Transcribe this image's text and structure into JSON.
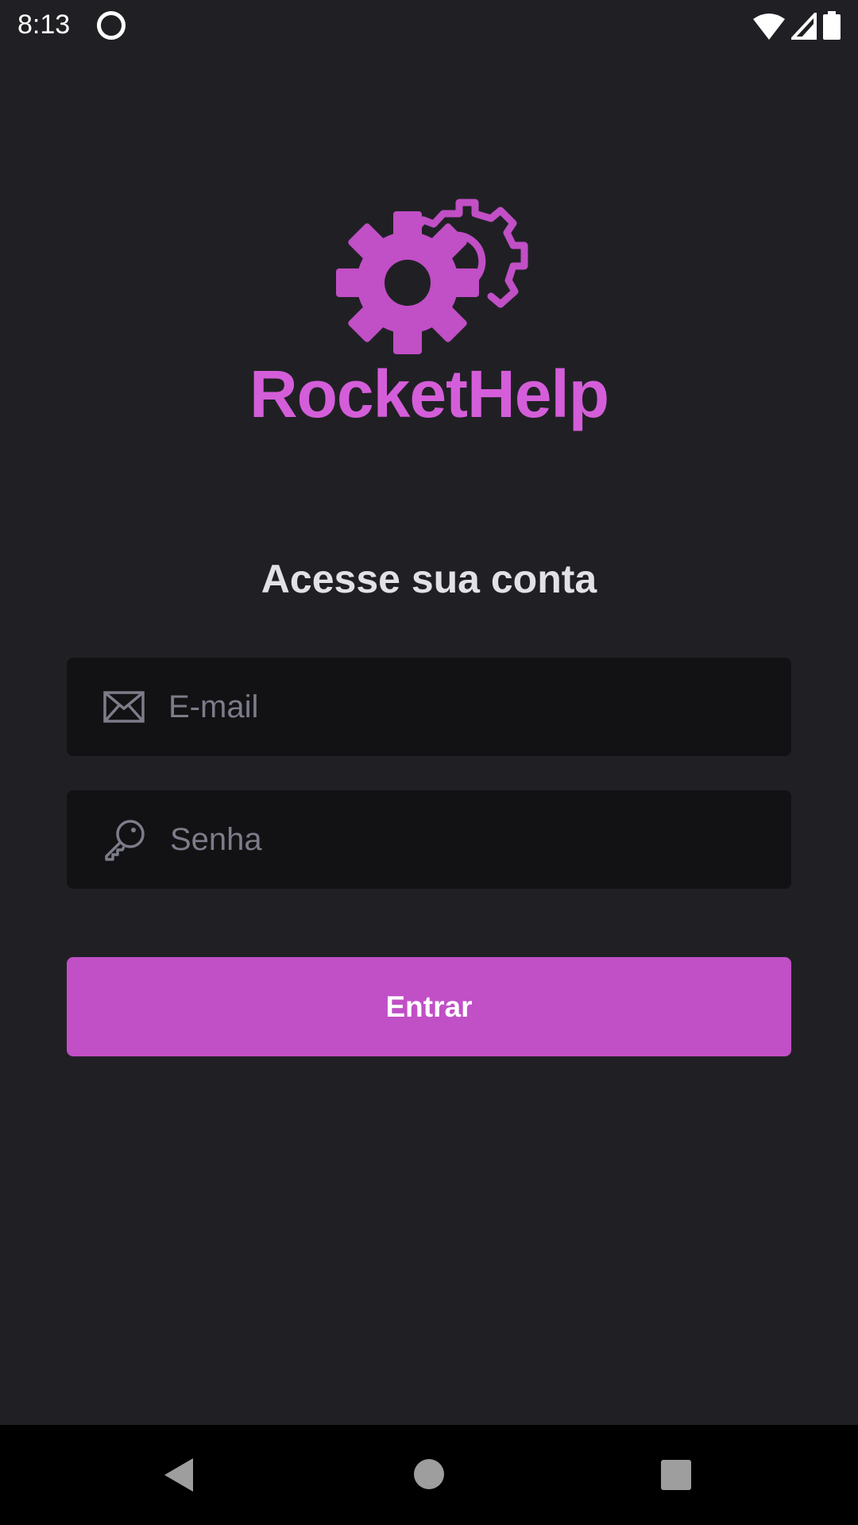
{
  "status_bar": {
    "time": "8:13"
  },
  "brand": {
    "name": "RocketHelp",
    "color": "#C14FC6"
  },
  "login": {
    "title": "Acesse sua conta",
    "email_placeholder": "E-mail",
    "password_placeholder": "Senha",
    "submit_label": "Entrar"
  }
}
